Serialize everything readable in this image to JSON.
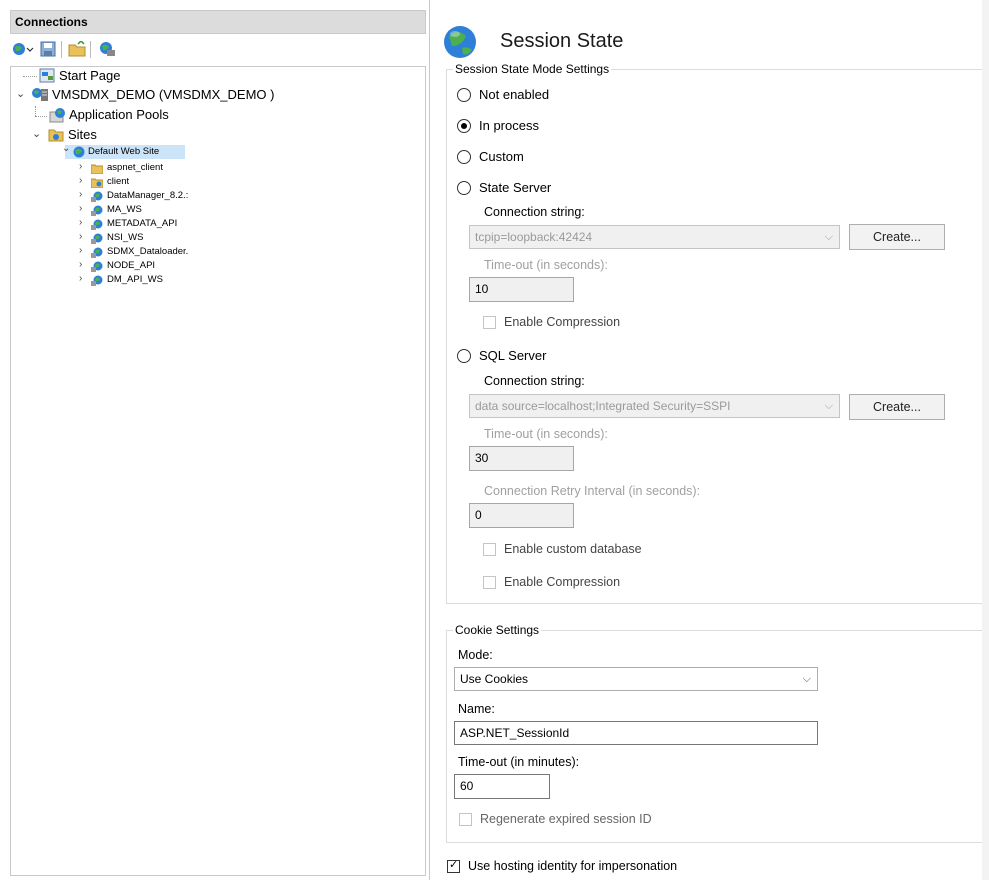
{
  "connections": {
    "title": "Connections",
    "tree": {
      "start_page": "Start Page",
      "server": "VMSDMX_DEMO (VMSDMX_DEMO )",
      "app_pools": "Application Pools",
      "sites": "Sites",
      "default_site": "Default Web Site",
      "children": [
        "aspnet_client",
        "client",
        "DataManager_8.2.:",
        "MA_WS",
        "METADATA_API",
        "NSI_WS",
        "SDMX_Dataloader.",
        "NODE_API",
        "DM_API_WS"
      ]
    }
  },
  "session_state": {
    "title": "Session State",
    "mode_legend": "Session State Mode Settings",
    "modes": {
      "not_enabled": "Not enabled",
      "in_process": "In process",
      "custom": "Custom",
      "state_server": "State Server",
      "sql_server": "SQL Server"
    },
    "selected_mode": "In process",
    "state_server": {
      "conn_label": "Connection string:",
      "conn_value": "tcpip=loopback:42424",
      "create": "Create...",
      "timeout_label": "Time-out (in seconds):",
      "timeout_value": "10",
      "compression": "Enable Compression"
    },
    "sql_server": {
      "conn_label": "Connection string:",
      "conn_value": "data source=localhost;Integrated Security=SSPI",
      "create": "Create...",
      "timeout_label": "Time-out (in seconds):",
      "timeout_value": "30",
      "retry_label": "Connection Retry Interval (in seconds):",
      "retry_value": "0",
      "custom_db": "Enable custom database",
      "compression": "Enable Compression"
    },
    "cookie": {
      "legend": "Cookie Settings",
      "mode_label": "Mode:",
      "mode_value": "Use Cookies",
      "name_label": "Name:",
      "name_value": "ASP.NET_SessionId",
      "timeout_label": "Time-out (in minutes):",
      "timeout_value": "60",
      "regenerate": "Regenerate expired session ID"
    },
    "hosting_identity": "Use hosting identity for impersonation",
    "hosting_identity_checked": true
  },
  "colors": {
    "globe_blue": "#2e7fd8",
    "globe_green": "#4caf50",
    "folder": "#e8c15a",
    "header_bg": "#dcdcdc"
  },
  "icons": [
    "globe-icon",
    "folder-icon",
    "server-icon",
    "start-page-icon",
    "app-pools-icon",
    "sites-icon",
    "save-icon",
    "connect-icon"
  ]
}
